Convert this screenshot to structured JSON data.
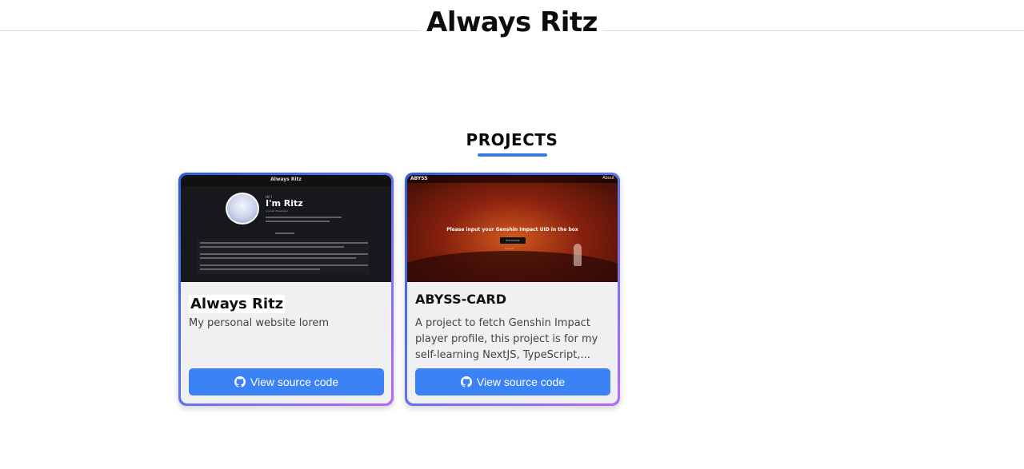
{
  "header": {
    "title": "Always Ritz"
  },
  "projects": {
    "heading": "PROJECTS",
    "cards": [
      {
        "title": "Always Ritz",
        "description": "My personal website lorem",
        "button_label": "View source code",
        "thumbnail": {
          "bar_title": "Always Ritz",
          "greeting": "Hi! I",
          "headline": "I'm Ritz",
          "subtitle": "A Junior Developer"
        }
      },
      {
        "title": "ABYSS-CARD",
        "description": "A project to fetch Genshin Impact player profile, this project is for my self-learning NextJS, TypeScript,...",
        "button_label": "View source code",
        "thumbnail": {
          "logo": "ABYSS",
          "about": "About",
          "prompt": "Please input your Genshin Impact UID in the box",
          "input_value": "800104402",
          "submit": "Submit"
        }
      }
    ]
  },
  "colors": {
    "accent": "#3b82f6",
    "underline": "#3a7ae0",
    "card_border_start": "#2b5fd8",
    "card_border_end": "#b36cf2"
  },
  "icons": {
    "button_icon": "github-icon"
  }
}
